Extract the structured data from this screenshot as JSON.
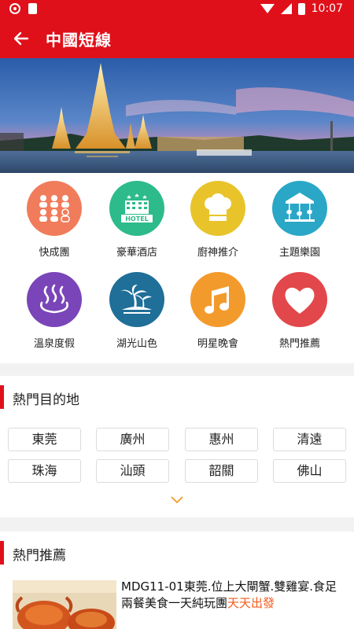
{
  "status_bar": {
    "time": "10:07",
    "icons": [
      "notification-icon",
      "sd-card-icon",
      "wifi-icon",
      "signal-icon",
      "battery-icon"
    ]
  },
  "app_bar": {
    "title": "中國短線",
    "back_icon": "arrow-left-icon"
  },
  "banner": {
    "image": "temple-by-river-at-dusk"
  },
  "categories": [
    {
      "label": "快成團",
      "icon": "group-people-icon",
      "color": "#f07c5c"
    },
    {
      "label": "豪華酒店",
      "icon": "hotel-icon",
      "color": "#2dbb8c"
    },
    {
      "label": "廚神推介",
      "icon": "chef-hat-icon",
      "color": "#e8c42a"
    },
    {
      "label": "主題樂園",
      "icon": "carousel-icon",
      "color": "#2aa7c6"
    },
    {
      "label": "溫泉度假",
      "icon": "hot-spring-icon",
      "color": "#7a45b8"
    },
    {
      "label": "湖光山色",
      "icon": "palm-island-icon",
      "color": "#1f6f98"
    },
    {
      "label": "明星晚會",
      "icon": "music-note-icon",
      "color": "#f39a2c"
    },
    {
      "label": "熱門推薦",
      "icon": "heart-icon",
      "color": "#e2474b"
    }
  ],
  "hot_destinations": {
    "title": "熱門目的地",
    "cities": [
      "東莞",
      "廣州",
      "惠州",
      "清遠",
      "珠海",
      "汕頭",
      "韶關",
      "佛山"
    ],
    "expand_icon": "chevron-down-icon"
  },
  "hot_recommend": {
    "title": "熱門推薦",
    "item": {
      "text": "MDG11-01東莞.位上大閘蟹.雙雞宴.食足兩餐美食一天純玩團",
      "highlight": "天天出發",
      "image": "hairy-crab-dish"
    }
  },
  "colors": {
    "primary": "#e0101a",
    "highlight": "#f25b1e"
  }
}
